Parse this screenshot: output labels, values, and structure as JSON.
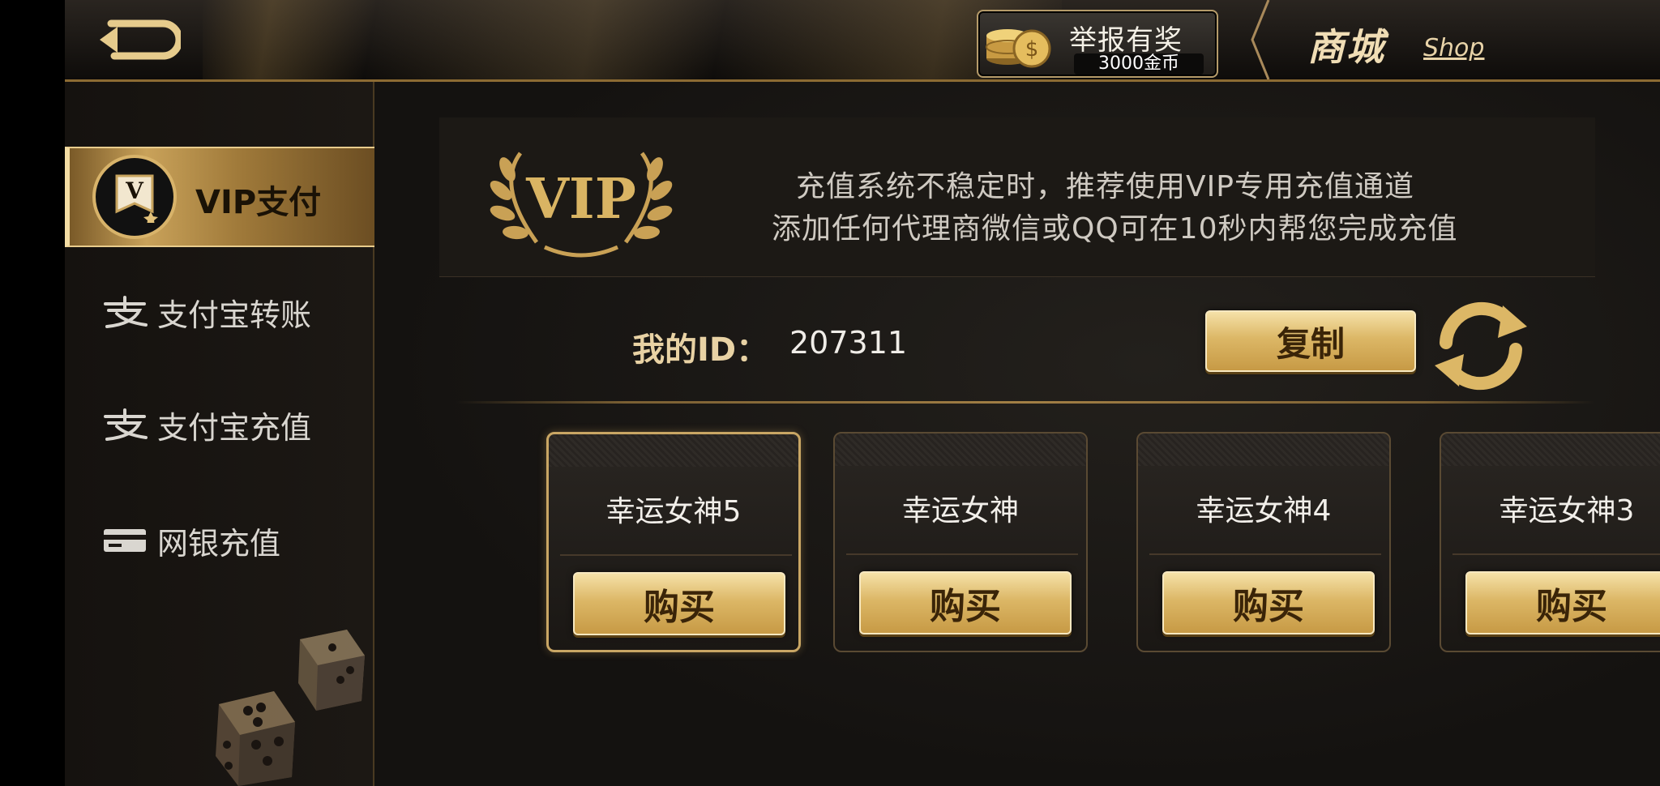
{
  "header": {
    "back_icon": "back-arrow-icon",
    "report": {
      "title": "举报有奖",
      "reward": "3000金币",
      "icon": "gold-coins-icon"
    },
    "title_cn": "商城",
    "title_en": "Shop"
  },
  "sidebar": {
    "items": [
      {
        "label": "VIP支付",
        "icon": "vip-badge-icon",
        "active": true
      },
      {
        "label": "支付宝转账",
        "icon": "alipay-icon"
      },
      {
        "label": "支付宝充值",
        "icon": "alipay-icon"
      },
      {
        "label": "网银充值",
        "icon": "bank-card-icon"
      }
    ]
  },
  "vip": {
    "logo_text": "VIP",
    "line1": "充值系统不稳定时，推荐使用VIP专用充值通道",
    "line2": "添加任何代理商微信或QQ可在10秒内帮您完成充值"
  },
  "account": {
    "id_label": "我的ID：",
    "id_value": "207311",
    "copy_label": "复制"
  },
  "cards": [
    {
      "name": "幸运女神5",
      "buy_label": "购买"
    },
    {
      "name": "幸运女神",
      "buy_label": "购买"
    },
    {
      "name": "幸运女神4",
      "buy_label": "购买"
    },
    {
      "name": "幸运女神3",
      "buy_label": "购买"
    }
  ],
  "colors": {
    "gold": "#d8b36a",
    "gold_light": "#f5e1a8",
    "background": "#141210",
    "text": "#cfcac2"
  }
}
